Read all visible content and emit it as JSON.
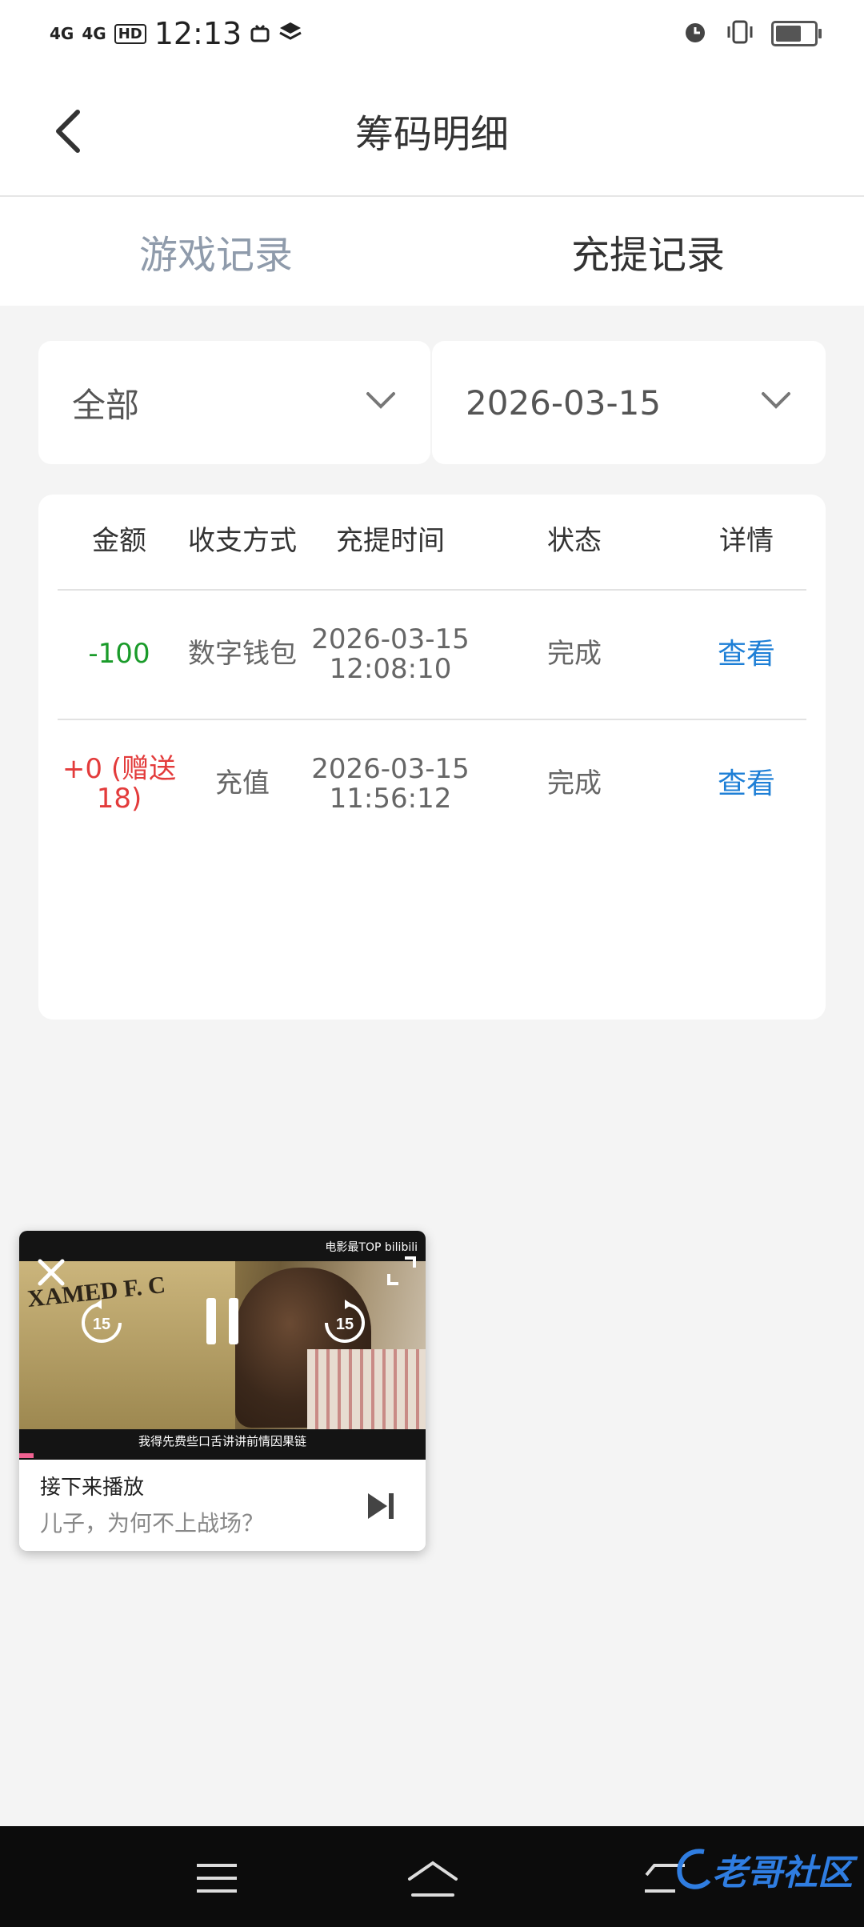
{
  "status_bar": {
    "signal1": "4G",
    "signal2": "4G",
    "hd": "HD",
    "time": "12:13"
  },
  "header": {
    "title": "筹码明细"
  },
  "tabs": [
    {
      "label": "游戏记录",
      "active": false
    },
    {
      "label": "充提记录",
      "active": true
    }
  ],
  "filters": {
    "type_value": "全部",
    "date_value": "2026-03-15"
  },
  "table": {
    "headers": [
      "金额",
      "收支方式",
      "充提时间",
      "状态",
      "详情"
    ],
    "rows": [
      {
        "amount": "-100",
        "method": "数字钱包",
        "date": "2026-03-15",
        "time": "12:08:10",
        "status": "完成",
        "detail": "查看"
      },
      {
        "amount_line1": "+0 (赠送",
        "amount_line2": "18)",
        "method": "充值",
        "date": "2026-03-15",
        "time": "11:56:12",
        "status": "完成",
        "detail": "查看"
      }
    ]
  },
  "pip": {
    "top_right_text": "电影最TOP bilibili",
    "subtitle": "我得先费些口舌讲讲前情因果链",
    "next_label": "接下来播放",
    "next_title": "儿子，为何不上战场？",
    "skip_seconds": "15",
    "progress": 0.035
  },
  "watermark": {
    "text": "老哥社区"
  },
  "colors": {
    "negative": "#1a9b2a",
    "positive": "#e33b3b",
    "link": "#1e7fd6",
    "inactive_tab": "#8f9bab"
  }
}
